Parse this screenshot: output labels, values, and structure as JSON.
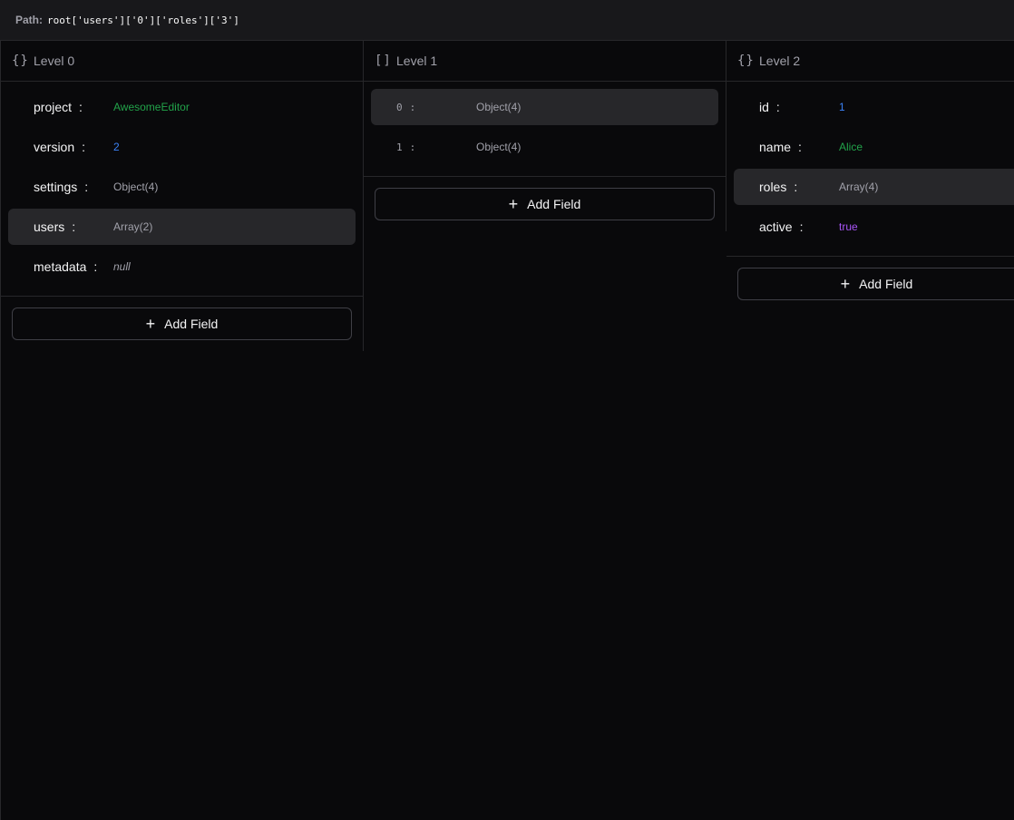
{
  "path": {
    "label": "Path:",
    "value": "root['users']['0']['roles']['3']"
  },
  "columns": [
    {
      "icon": "{}",
      "title": "Level 0",
      "rows": [
        {
          "key": "project",
          "sep": ":",
          "value": "AwesomeEditor",
          "type": "string"
        },
        {
          "key": "version",
          "sep": ":",
          "value": "2",
          "type": "number"
        },
        {
          "key": "settings",
          "sep": ":",
          "value": "Object(4)",
          "type": "object"
        },
        {
          "key": "users",
          "sep": ":",
          "value": "Array(2)",
          "type": "object",
          "selected": true
        },
        {
          "key": "metadata",
          "sep": ":",
          "value": "null",
          "type": "null"
        }
      ],
      "add_label": "Add Field"
    },
    {
      "icon": "[]",
      "title": "Level 1",
      "rows": [
        {
          "key": "0",
          "sep": ":",
          "value": "Object(4)",
          "type": "object",
          "selected": true
        },
        {
          "key": "1",
          "sep": ":",
          "value": "Object(4)",
          "type": "object"
        }
      ],
      "add_label": "Add Field"
    },
    {
      "icon": "{}",
      "title": "Level 2",
      "rows": [
        {
          "key": "id",
          "sep": ":",
          "value": "1",
          "type": "number"
        },
        {
          "key": "name",
          "sep": ":",
          "value": "Alice",
          "type": "string"
        },
        {
          "key": "roles",
          "sep": ":",
          "value": "Array(4)",
          "type": "object",
          "selected": true
        },
        {
          "key": "active",
          "sep": ":",
          "value": "true",
          "type": "bool"
        }
      ],
      "add_label": "Add Field"
    }
  ],
  "colors": {
    "string": "#22a34a",
    "number": "#3b82f6",
    "bool": "#a855f7",
    "selected_bg": "#27272a"
  }
}
